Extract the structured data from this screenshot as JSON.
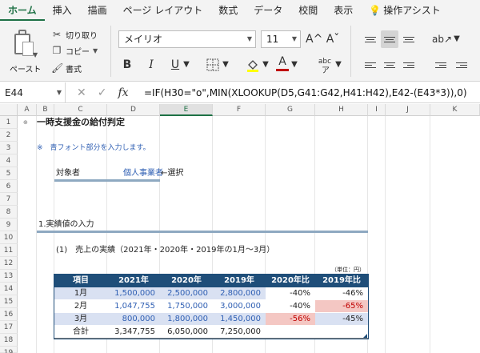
{
  "ribbon": {
    "tabs": [
      "ホーム",
      "挿入",
      "描画",
      "ページ レイアウト",
      "数式",
      "データ",
      "校閲",
      "表示",
      "操作アシスト"
    ],
    "paste_label": "ペースト",
    "cut_label": "切り取り",
    "copy_label": "コピー",
    "format_painter_label": "書式",
    "font_name": "メイリオ",
    "font_size": "11",
    "bold": "B",
    "italic": "I",
    "underline": "U",
    "grow_font": "A^",
    "shrink_font": "Aˇ",
    "font_color_letter": "A",
    "phonetic_label": "abc",
    "accent_color": "#1e7145",
    "font_color_swatch": "#c00000",
    "fill_color_swatch": "#ffff00"
  },
  "formula_bar": {
    "name_box": "E44",
    "formula": "=IF(H30=\"o\",MIN(XLOOKUP(D5,G41:G42,H41:H42),E42-(E43*3)),0)"
  },
  "grid": {
    "columns": [
      "A",
      "B",
      "C",
      "D",
      "E",
      "F",
      "G",
      "H",
      "I",
      "J",
      "K"
    ],
    "rows": [
      "1",
      "2",
      "3",
      "4",
      "5",
      "6",
      "7",
      "8",
      "9",
      "10",
      "11",
      "12",
      "13",
      "14",
      "15",
      "16",
      "17",
      "18",
      "19"
    ]
  },
  "sheet": {
    "title": "一時支援金の給付判定",
    "note": "※　青フォント部分を入力します。",
    "target_label": "対象者",
    "target_value": "個人事業者",
    "target_select": "←選択",
    "section1": "1.実績値の入力",
    "subsection": "(1)　売上の実績（2021年・2020年・2019年の1月～3月）",
    "unit": "（単位：円）"
  },
  "table": {
    "headers": [
      "項目",
      "2021年",
      "2020年",
      "2019年",
      "2020年比",
      "2019年比"
    ],
    "rows": [
      {
        "label": "1月",
        "y2021": "1,500,000",
        "y2020": "2,500,000",
        "y2019": "2,800,000",
        "r2020": "-40%",
        "r2019": "-46%"
      },
      {
        "label": "2月",
        "y2021": "1,047,755",
        "y2020": "1,750,000",
        "y2019": "3,000,000",
        "r2020": "-40%",
        "r2019": "-65%"
      },
      {
        "label": "3月",
        "y2021": "800,000",
        "y2020": "1,800,000",
        "y2019": "1,450,000",
        "r2020": "-56%",
        "r2019": "-45%"
      }
    ],
    "total": {
      "label": "合計",
      "y2021": "3,347,755",
      "y2020": "6,050,000",
      "y2019": "7,250,000"
    }
  }
}
